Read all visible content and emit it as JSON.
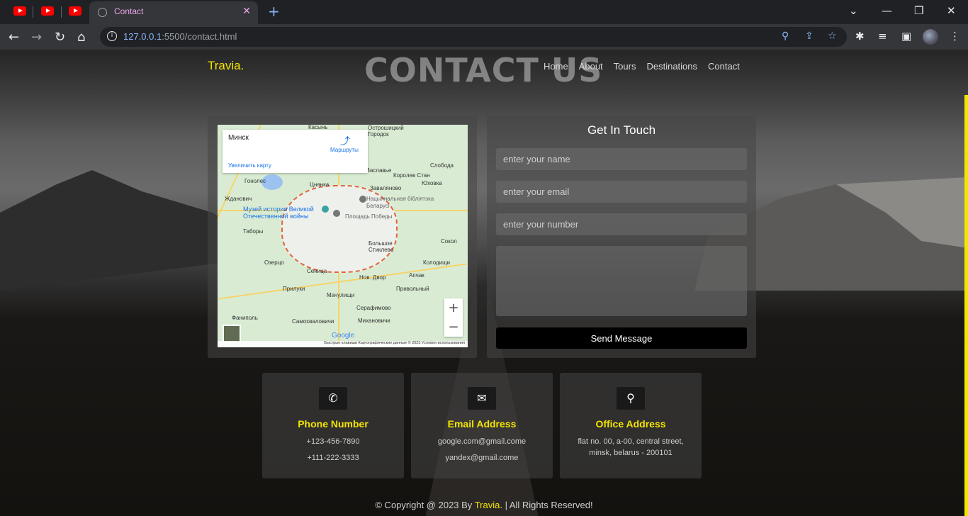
{
  "browser": {
    "tab_title": "Contact",
    "url_host": "127.0.0.1",
    "url_rest": ":5500/contact.html"
  },
  "site": {
    "logo": "Travia.",
    "hero_title": "CONTACT US",
    "nav": [
      "Home",
      "About",
      "Tours",
      "Destinations",
      "Contact"
    ]
  },
  "map": {
    "place": "Минск",
    "directions": "Маршруты",
    "enlarge": "Увеличить карту",
    "labels": [
      "Жданович",
      "Гонолес",
      "Цнянка",
      "Заславье",
      "Заваляново",
      "Музей истории Великой Отечественной войны",
      "Нацыянальная бібліятэка Беларусі",
      "Площадь Победы",
      "Таборы",
      "Большое Стиклево",
      "Озерцо",
      "Сеница",
      "Прилуки",
      "Мачулищи",
      "Нов. Двор",
      "Привольный",
      "Колодищи",
      "Серафимово",
      "Фаниполь",
      "Самохваловичи",
      "Михановичи",
      "Королев Стан",
      "Юховка",
      "Сокол",
      "Апчак",
      "Слобода",
      "Касынь",
      "Острошицкий Городок"
    ],
    "footer_text": "Быстрые клавиши   Картографические данные © 2023   Условия использования",
    "google": "Google",
    "zoom_in": "+",
    "zoom_out": "−"
  },
  "form": {
    "title": "Get In Touch",
    "name_placeholder": "enter your name",
    "email_placeholder": "enter your email",
    "number_placeholder": "enter your number",
    "message_value": "",
    "send_label": "Send Message"
  },
  "info": [
    {
      "icon": "phone-icon",
      "glyph": "✆",
      "title": "Phone Number",
      "lines": [
        "+123-456-7890",
        "+111-222-3333"
      ]
    },
    {
      "icon": "envelope-icon",
      "glyph": "✉",
      "title": "Email Address",
      "lines": [
        "google.com@gmail.come",
        "yandex@gmail.come"
      ]
    },
    {
      "icon": "map-pin-icon",
      "glyph": "⚲",
      "title": "Office Address",
      "lines": [
        "flat no. 00, a-00, central street,",
        "minsk, belarus - 200101"
      ]
    }
  ],
  "footer": {
    "prefix": "© Copyright @ 2023 By",
    "brand": "Travia.",
    "suffix": "| All Rights Reserved!"
  },
  "colors": {
    "accent": "#f5e400",
    "send_button": "#000000"
  }
}
